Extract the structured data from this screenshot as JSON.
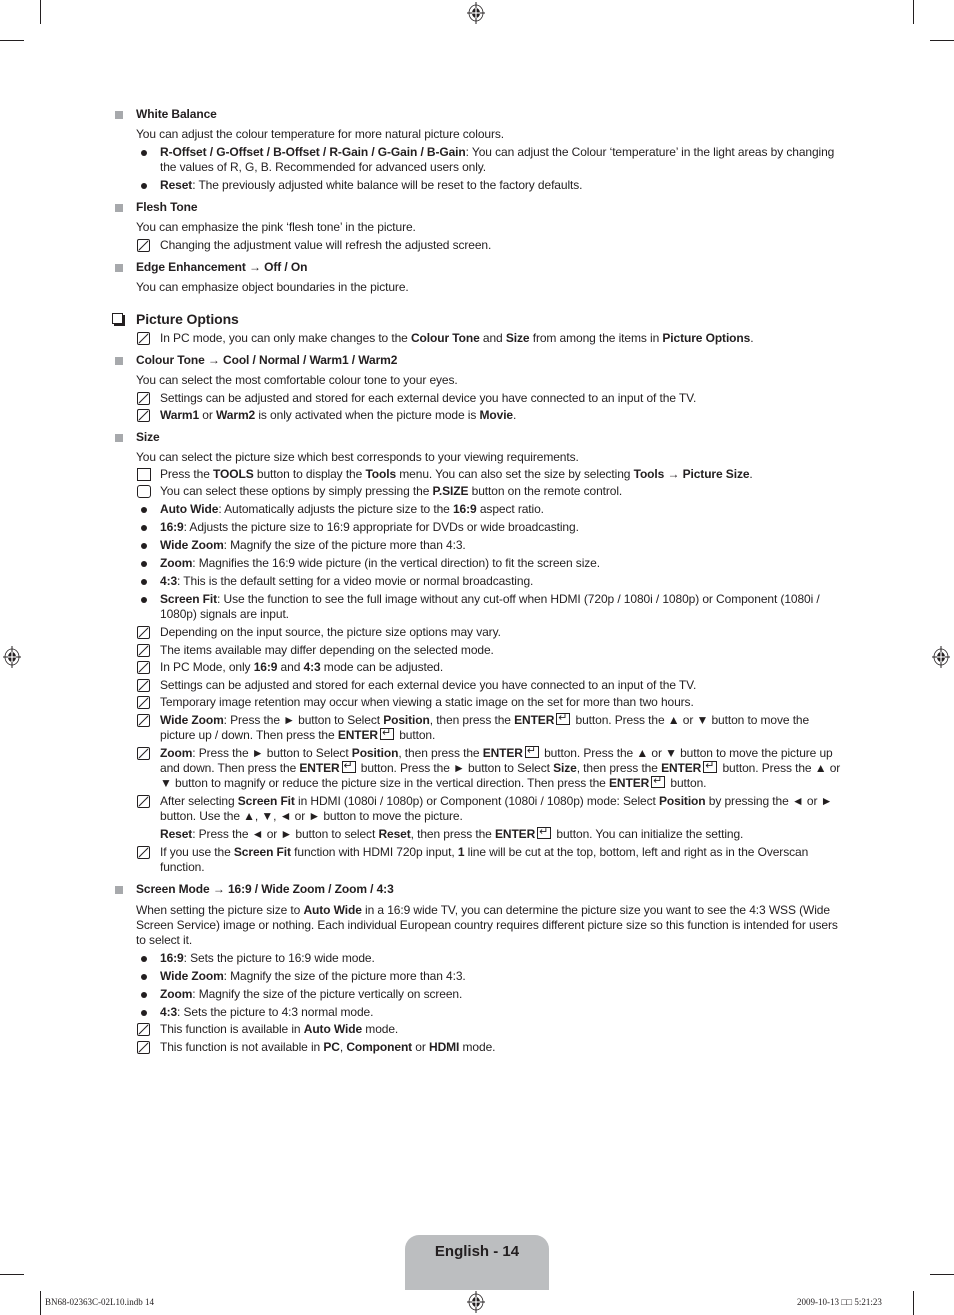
{
  "sections": {
    "white_balance": {
      "heading": "White Balance",
      "intro": "You can adjust the colour temperature for more natural picture colours.",
      "bullets": [
        {
          "bold": "R-Offset / G-Offset / B-Offset / R-Gain / G-Gain / B-Gain",
          "text": ": You can adjust the Colour ‘temperature’ in the light areas by changing the values of R, G, B. Recommended for advanced users only."
        },
        {
          "bold": "Reset",
          "text": ": The previously adjusted white balance will be reset to the factory defaults."
        }
      ]
    },
    "flesh_tone": {
      "heading": "Flesh Tone",
      "intro": "You can emphasize the pink ‘flesh tone’ in the picture.",
      "note": "Changing the adjustment value will refresh the adjusted screen."
    },
    "edge_enhancement": {
      "heading": "Edge Enhancement → Off / On",
      "intro": "You can emphasize object boundaries in the picture."
    },
    "picture_options": {
      "heading": "Picture Options",
      "note_parts": [
        "In PC mode, you can only make changes to the ",
        "Colour Tone",
        " and ",
        "Size",
        " from among the items in ",
        "Picture Options",
        "."
      ]
    },
    "colour_tone": {
      "heading": "Colour Tone → Cool / Normal / Warm1 / Warm2",
      "intro": "You can select the most comfortable colour tone to your eyes.",
      "note1": "Settings can be adjusted and stored for each external device you have connected to an input of the TV.",
      "note2_parts": [
        "Warm1",
        " or ",
        "Warm2",
        " is only activated when the picture mode is ",
        "Movie",
        "."
      ]
    },
    "size": {
      "heading": "Size",
      "intro": "You can select the picture size which best corresponds to your viewing requirements.",
      "tools_parts": [
        "Press the ",
        "TOOLS",
        " button to display the ",
        "Tools",
        " menu. You can also set the size by selecting ",
        "Tools → Picture Size",
        "."
      ],
      "psize_parts": [
        "You can select these options by simply pressing the ",
        "P.SIZE",
        " button on the remote control."
      ],
      "bullets": [
        {
          "bold": "Auto Wide",
          "text": ": Automatically adjusts the picture size to the ",
          "bold2": "16:9",
          "text2": " aspect ratio."
        },
        {
          "bold": "16:9",
          "text": ": Adjusts the picture size to 16:9 appropriate for DVDs or wide broadcasting."
        },
        {
          "bold": "Wide Zoom",
          "text": ": Magnify the size of the picture more than 4:3."
        },
        {
          "bold": "Zoom",
          "text": ": Magnifies the 16:9 wide picture (in the vertical direction) to fit the screen size."
        },
        {
          "bold": "4:3",
          "text": ": This is the default setting for a video movie or normal broadcasting."
        },
        {
          "bold": "Screen Fit",
          "text": ": Use the function to see the full image without any cut-off when HDMI (720p / 1080i / 1080p) or Component (1080i / 1080p) signals are input."
        }
      ],
      "notes": [
        "Depending on the input source, the picture size options may vary.",
        "The items available may differ depending on the selected mode."
      ],
      "note_pc_parts": [
        "In PC Mode, only ",
        "16:9",
        " and ",
        "4:3",
        " mode can be adjusted."
      ],
      "notes2": [
        "Settings can be adjusted and stored for each external device you have connected to an input of the TV.",
        "Temporary image retention may occur when viewing a static image on the set for more than two hours."
      ],
      "wide_zoom_note": [
        "Wide Zoom",
        ": Press the ► button to Select ",
        "Position",
        ", then press the ",
        "ENTER",
        " button. Press the ▲ or ▼ button to move the picture up / down. Then press the ",
        "ENTER",
        " button."
      ],
      "zoom_note": [
        "Zoom",
        ": Press the ► button to Select ",
        "Position",
        ", then press the ",
        "ENTER",
        " button. Press the ▲ or ▼ button to move the picture up and down. Then press the ",
        "ENTER",
        " button. Press the ► button to Select ",
        "Size",
        ", then press the ",
        "ENTER",
        " button. Press the ▲ or ▼ button to magnify or reduce the picture size in the vertical direction. Then press the ",
        "ENTER",
        " button."
      ],
      "screenfit_note": [
        "After selecting ",
        "Screen Fit",
        " in HDMI (1080i / 1080p) or Component (1080i / 1080p) mode: Select ",
        "Position",
        " by pressing the ◄ or ► button. Use the ▲, ▼, ◄ or ► button to move the picture."
      ],
      "reset_line": [
        "Reset",
        ": Press the ◄ or ► button to select ",
        "Reset",
        ", then press the ",
        "ENTER",
        " button. You can initialize the setting."
      ],
      "hdmi_note": [
        "If you use the ",
        "Screen Fit",
        " function with HDMI 720p input, ",
        "1",
        " line will be cut at the top, bottom, left and right as in the Overscan function."
      ]
    },
    "screen_mode": {
      "heading": "Screen Mode → 16:9 / Wide Zoom / Zoom / 4:3",
      "intro_parts": [
        "When setting the picture size to ",
        "Auto Wide",
        " in a 16:9 wide TV, you can determine the picture size you want to see the 4:3 WSS (Wide Screen Service) image or nothing. Each individual European country requires different picture size so this function is intended for users to select it."
      ],
      "bullets": [
        {
          "bold": "16:9",
          "text": ": Sets the picture to 16:9 wide mode."
        },
        {
          "bold": "Wide Zoom",
          "text": ": Magnify the size of the picture more than 4:3."
        },
        {
          "bold": "Zoom",
          "text": ": Magnify the size of the picture vertically on screen."
        },
        {
          "bold": "4:3",
          "text": ": Sets the picture to 4:3 normal mode."
        }
      ],
      "note1_parts": [
        "This function is available in ",
        "Auto Wide",
        " mode."
      ],
      "note2_parts": [
        "This function is not available in ",
        "PC",
        ", ",
        "Component",
        " or ",
        "HDMI",
        " mode."
      ]
    }
  },
  "footer": {
    "page_label": "English - 14",
    "file_slug": "BN68-02363C-02L10.indb   14",
    "date_slug": "2009-10-13   □□ 5:21:23"
  }
}
